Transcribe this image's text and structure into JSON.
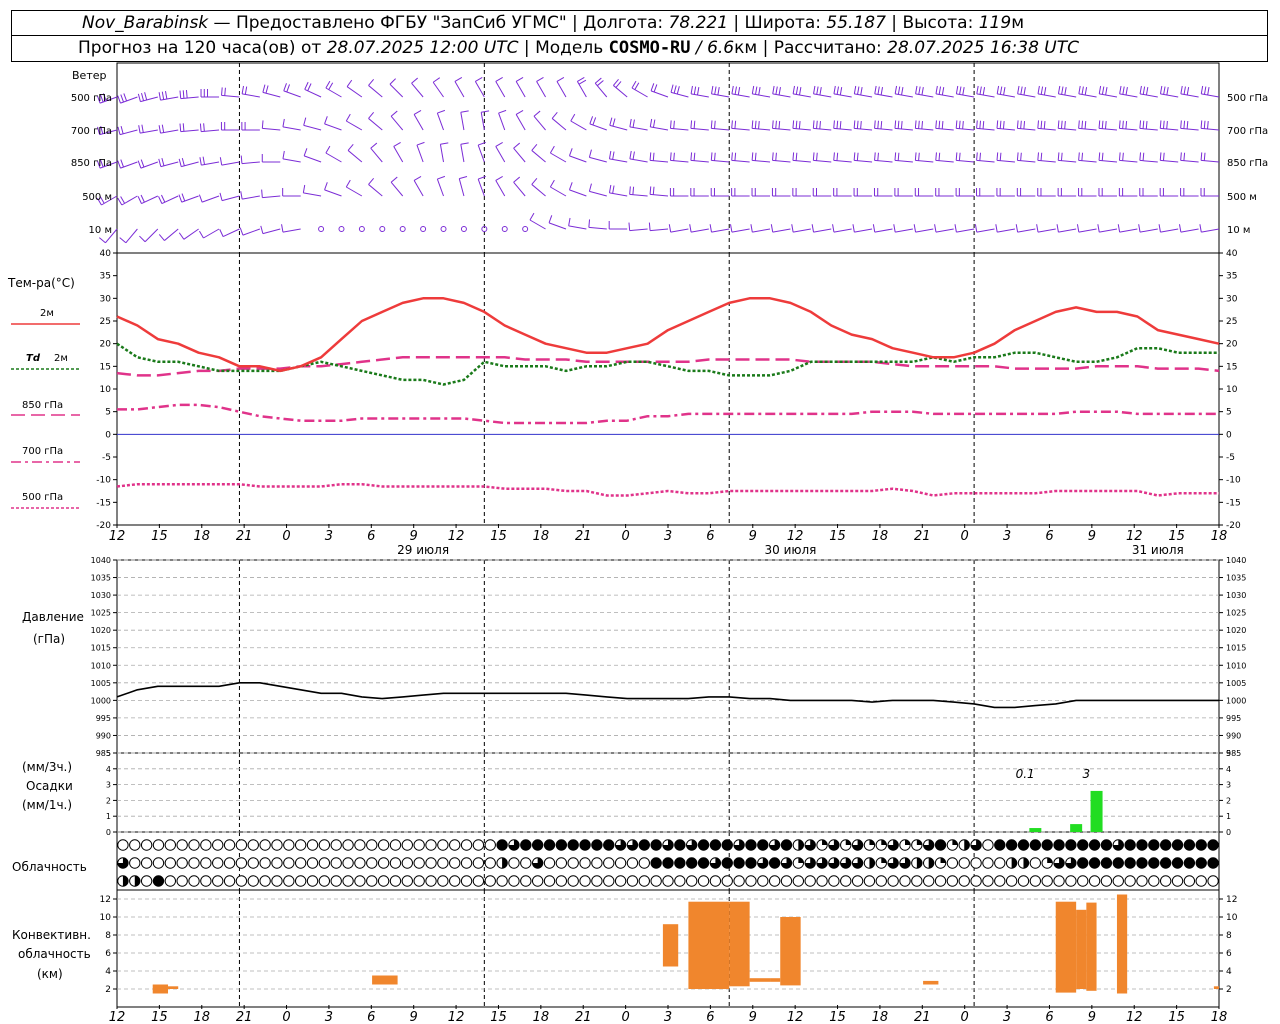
{
  "header": {
    "station": "Nov_Barabinsk",
    "sep1": " — Предоставлено ФГБУ \"ЗапСиб УГМС\" | Долгота: ",
    "lon": "78.221",
    "sep2": " | Широта: ",
    "lat": "55.187",
    "sep3": " | Высота: ",
    "alt": "119",
    "alt_unit": "м",
    "forecast_prefix": "Прогноз на 120 часа(ов) от ",
    "init_time": "28.07.2025 12:00 UTC",
    "model_prefix": " | Модель ",
    "model": "COSMO-RU",
    "res": " / 6.6",
    "res_unit": "км",
    "calc_prefix": " | Рассчитано: ",
    "calc_time": "28.07.2025 16:38 UTC"
  },
  "labels": {
    "wind": "Ветер",
    "wind_levels": [
      "500 гПа",
      "700 гПа",
      "850 гПа",
      "500 м",
      "10 м"
    ],
    "temp_title": "Тем-ра(°С)",
    "t2m": "2м",
    "td_name": "Td",
    "td_level": "2м",
    "l850": "850 гПа",
    "l700": "700 гПа",
    "l500": "500 гПа",
    "pressure": "Давление",
    "pressure_unit": "(гПа)",
    "precip_unit1": "(мм/3ч.)",
    "precip_name": "Осадки",
    "precip_unit2": "(мм/1ч.)",
    "cloud": "Облачность",
    "conv1": "Конвективн.",
    "conv2": "облачность",
    "conv3": "(км)"
  },
  "colors": {
    "t2m": "#ee3b3b",
    "td": "#1a7a1a",
    "t850": "#e0338a",
    "t700": "#e0338a",
    "t500": "#e0338a",
    "wind": "#7b2cd6",
    "pressure": "#000000",
    "precip": "#22dd22",
    "conv": "#f0862d",
    "zero_line": "#3333cc"
  },
  "chart_data": {
    "type": "line",
    "x_hour_ticks": [
      "12",
      "15",
      "18",
      "21",
      "0",
      "3",
      "6",
      "9",
      "12",
      "15",
      "18",
      "21",
      "0",
      "3",
      "6",
      "9",
      "12",
      "15",
      "18",
      "21",
      "0",
      "3",
      "6",
      "9",
      "12",
      "15",
      "18"
    ],
    "day_labels": [
      "29 июля",
      "30 июля",
      "31 июля"
    ],
    "temperature": {
      "ylim": [
        -20,
        40
      ],
      "yticks": [
        -20,
        -15,
        -10,
        -5,
        0,
        5,
        10,
        15,
        20,
        25,
        30,
        35,
        40
      ],
      "t2m": [
        26,
        24,
        21,
        20,
        18,
        17,
        15,
        15,
        14,
        15,
        17,
        21,
        25,
        27,
        29,
        30,
        30,
        29,
        27,
        24,
        22,
        20,
        19,
        18,
        18,
        19,
        20,
        23,
        25,
        27,
        29,
        30,
        30,
        29,
        27,
        24,
        22,
        21,
        19,
        18,
        17,
        17,
        18,
        20,
        23,
        25,
        27,
        28,
        27,
        27,
        26,
        23,
        22,
        21,
        20
      ],
      "td2m": [
        20,
        17,
        16,
        16,
        15,
        14,
        14,
        14,
        14,
        15,
        16,
        15,
        14,
        13,
        12,
        12,
        11,
        12,
        16,
        15,
        15,
        15,
        14,
        15,
        15,
        16,
        16,
        15,
        14,
        14,
        13,
        13,
        13,
        14,
        16,
        16,
        16,
        16,
        16,
        16,
        17,
        16,
        17,
        17,
        18,
        18,
        17,
        16,
        16,
        17,
        19,
        19,
        18,
        18,
        18
      ],
      "t850": [
        13.5,
        13,
        13,
        13.5,
        14,
        14,
        14.5,
        14.5,
        14.5,
        15,
        15,
        15.5,
        16,
        16.5,
        17,
        17,
        17,
        17,
        17,
        17,
        16.5,
        16.5,
        16.5,
        16,
        16,
        16,
        16,
        16,
        16,
        16.5,
        16.5,
        16.5,
        16.5,
        16.5,
        16,
        16,
        16,
        16,
        15.5,
        15,
        15,
        15,
        15,
        15,
        14.5,
        14.5,
        14.5,
        14.5,
        15,
        15,
        15,
        14.5,
        14.5,
        14.5,
        14
      ],
      "t700": [
        5.5,
        5.5,
        6,
        6.5,
        6.5,
        6,
        5,
        4,
        3.5,
        3,
        3,
        3,
        3.5,
        3.5,
        3.5,
        3.5,
        3.5,
        3.5,
        3,
        2.5,
        2.5,
        2.5,
        2.5,
        2.5,
        3,
        3,
        4,
        4,
        4.5,
        4.5,
        4.5,
        4.5,
        4.5,
        4.5,
        4.5,
        4.5,
        4.5,
        5,
        5,
        5,
        4.5,
        4.5,
        4.5,
        4.5,
        4.5,
        4.5,
        4.5,
        5,
        5,
        5,
        4.5,
        4.5,
        4.5,
        4.5,
        4.5
      ],
      "t500": [
        -11.5,
        -11,
        -11,
        -11,
        -11,
        -11,
        -11,
        -11.5,
        -11.5,
        -11.5,
        -11.5,
        -11,
        -11,
        -11.5,
        -11.5,
        -11.5,
        -11.5,
        -11.5,
        -11.5,
        -12,
        -12,
        -12,
        -12.5,
        -12.5,
        -13.5,
        -13.5,
        -13,
        -12.5,
        -13,
        -13,
        -12.5,
        -12.5,
        -12.5,
        -12.5,
        -12.5,
        -12.5,
        -12.5,
        -12.5,
        -12,
        -12.5,
        -13.5,
        -13,
        -13,
        -13,
        -13,
        -13,
        -12.5,
        -12.5,
        -12.5,
        -12.5,
        -12.5,
        -13.5,
        -13,
        -13,
        -13
      ]
    },
    "pressure": {
      "ylim": [
        985,
        1040
      ],
      "yticks": [
        985,
        990,
        995,
        1000,
        1005,
        1010,
        1015,
        1020,
        1025,
        1030,
        1035,
        1040
      ],
      "values": [
        1001,
        1003,
        1004,
        1004,
        1004,
        1004,
        1005,
        1005,
        1004,
        1003,
        1002,
        1002,
        1001,
        1000.5,
        1001,
        1001.5,
        1002,
        1002,
        1002,
        1002,
        1002,
        1002,
        1002,
        1001.5,
        1001,
        1000.5,
        1000.5,
        1000.5,
        1000.5,
        1001,
        1001,
        1000.5,
        1000.5,
        1000,
        1000,
        1000,
        1000,
        999.5,
        1000,
        1000,
        1000,
        999.5,
        999,
        998,
        998,
        998.5,
        999,
        1000,
        1000,
        1000,
        1000,
        1000,
        1000,
        1000,
        1000
      ]
    },
    "precip": {
      "ylim": [
        0,
        5
      ],
      "yticks": [
        0,
        1,
        2,
        3,
        4,
        5
      ],
      "bars": [
        {
          "hour": 90,
          "value": 0.25
        },
        {
          "hour": 94,
          "value": 0.5
        },
        {
          "hour": 96,
          "value": 2.6
        }
      ],
      "annotations": [
        {
          "hour": 89,
          "text": "0.1"
        },
        {
          "hour": 95,
          "text": "3"
        }
      ]
    },
    "convective": {
      "ylim": [
        0,
        13
      ],
      "yticks": [
        2,
        4,
        6,
        8,
        10,
        12
      ],
      "bars": [
        {
          "start": 3.5,
          "end": 5,
          "bottom": 1.5,
          "top": 2.5
        },
        {
          "start": 5,
          "end": 6,
          "bottom": 2,
          "top": 2.3
        },
        {
          "start": 25,
          "end": 27.5,
          "bottom": 2.5,
          "top": 3.5
        },
        {
          "start": 53.5,
          "end": 55,
          "bottom": 4.5,
          "top": 9.2
        },
        {
          "start": 56,
          "end": 60,
          "bottom": 2,
          "top": 11.7
        },
        {
          "start": 60,
          "end": 62,
          "bottom": 2.3,
          "top": 11.7
        },
        {
          "start": 62,
          "end": 64,
          "bottom": 2.8,
          "top": 3.2
        },
        {
          "start": 64,
          "end": 65,
          "bottom": 2.8,
          "top": 3.2
        },
        {
          "start": 65,
          "end": 67,
          "bottom": 2.4,
          "top": 10
        },
        {
          "start": 79,
          "end": 80.5,
          "bottom": 2.5,
          "top": 2.9
        },
        {
          "start": 92,
          "end": 94,
          "bottom": 1.6,
          "top": 11.7
        },
        {
          "start": 94,
          "end": 95,
          "bottom": 2,
          "top": 10.8
        },
        {
          "start": 95,
          "end": 96,
          "bottom": 1.8,
          "top": 11.6
        },
        {
          "start": 98,
          "end": 99,
          "bottom": 1.5,
          "top": 12.5
        },
        {
          "start": 107.5,
          "end": 108,
          "bottom": 2,
          "top": 2.3
        }
      ]
    },
    "cloud_rows": {
      "high": "000000000000000000000000000000004344444444334434344434434231313113113412304444444444344444444",
      "middle": "300000000000000000000000000000002003000000000444443444343133333213322100000220133444444444444",
      "low": "220400000000000000000000000000000000000000000000000000000000000000000000000000000000000000000"
    },
    "wind": {
      "levels": 5,
      "dir": [
        [
          250,
          250,
          255,
          260,
          265,
          270,
          275,
          280,
          285,
          290,
          295,
          300,
          305,
          310,
          315,
          320,
          325,
          330,
          330,
          330,
          330,
          330,
          330,
          330,
          320,
          310,
          300,
          290,
          285,
          280,
          280,
          280,
          280,
          280,
          280,
          280,
          280,
          280,
          280,
          280,
          280,
          280,
          280,
          280,
          280,
          280,
          280,
          280,
          280,
          280,
          280,
          280,
          280,
          280,
          280
        ],
        [
          255,
          255,
          260,
          260,
          265,
          265,
          270,
          270,
          275,
          280,
          285,
          290,
          300,
          310,
          320,
          330,
          340,
          350,
          350,
          340,
          330,
          320,
          310,
          300,
          290,
          285,
          280,
          280,
          275,
          275,
          275,
          275,
          275,
          275,
          275,
          275,
          275,
          275,
          275,
          275,
          275,
          275,
          275,
          275,
          275,
          275,
          275,
          275,
          275,
          275,
          275,
          275,
          275,
          275,
          275
        ],
        [
          250,
          250,
          250,
          255,
          255,
          260,
          260,
          265,
          270,
          280,
          290,
          300,
          310,
          320,
          330,
          340,
          350,
          350,
          340,
          330,
          320,
          310,
          300,
          290,
          285,
          280,
          280,
          275,
          275,
          275,
          275,
          275,
          275,
          275,
          275,
          275,
          275,
          275,
          275,
          275,
          275,
          275,
          275,
          275,
          275,
          275,
          275,
          275,
          275,
          275,
          275,
          275,
          275,
          275,
          275
        ],
        [
          240,
          240,
          245,
          245,
          250,
          250,
          255,
          260,
          265,
          270,
          280,
          290,
          300,
          310,
          320,
          330,
          340,
          345,
          340,
          330,
          320,
          310,
          300,
          290,
          285,
          280,
          275,
          275,
          270,
          270,
          270,
          270,
          270,
          270,
          270,
          270,
          270,
          270,
          270,
          270,
          270,
          270,
          270,
          270,
          270,
          270,
          270,
          270,
          270,
          270,
          270,
          270,
          270,
          270,
          270
        ],
        [
          220,
          220,
          225,
          230,
          235,
          240,
          245,
          250,
          255,
          260,
          270,
          280,
          290,
          300,
          310,
          320,
          330,
          335,
          330,
          320,
          310,
          300,
          290,
          280,
          275,
          270,
          265,
          265,
          260,
          260,
          260,
          260,
          260,
          260,
          260,
          260,
          260,
          260,
          260,
          260,
          260,
          260,
          260,
          260,
          260,
          260,
          260,
          260,
          260,
          260,
          260,
          260,
          260,
          260,
          260
        ]
      ],
      "speed": [
        [
          15,
          15,
          15,
          14,
          14,
          13,
          12,
          11,
          10,
          10,
          9,
          8,
          7,
          7,
          6,
          6,
          6,
          6,
          6,
          6,
          6,
          6,
          7,
          8,
          9,
          10,
          11,
          12,
          13,
          14,
          15,
          15,
          15,
          16,
          16,
          16,
          16,
          16,
          16,
          16,
          16,
          16,
          16,
          16,
          16,
          16,
          16,
          16,
          16,
          16,
          16,
          16,
          16,
          16,
          16
        ],
        [
          12,
          12,
          12,
          11,
          11,
          10,
          9,
          8,
          7,
          7,
          6,
          5,
          5,
          4,
          4,
          3,
          3,
          3,
          3,
          4,
          4,
          5,
          6,
          7,
          8,
          9,
          10,
          11,
          12,
          12,
          12,
          12,
          13,
          13,
          13,
          13,
          13,
          13,
          13,
          13,
          13,
          13,
          13,
          13,
          13,
          13,
          13,
          13,
          13,
          13,
          13,
          13,
          13,
          13,
          13
        ],
        [
          10,
          10,
          10,
          9,
          9,
          8,
          7,
          6,
          5,
          5,
          4,
          4,
          3,
          3,
          3,
          3,
          3,
          3,
          3,
          3,
          4,
          4,
          5,
          6,
          7,
          8,
          9,
          10,
          10,
          10,
          10,
          10,
          10,
          10,
          10,
          10,
          10,
          10,
          10,
          10,
          10,
          10,
          10,
          10,
          10,
          10,
          10,
          10,
          10,
          10,
          10,
          10,
          10,
          10,
          10
        ],
        [
          9,
          9,
          9,
          8,
          8,
          7,
          6,
          5,
          4,
          4,
          3,
          3,
          3,
          3,
          3,
          3,
          3,
          3,
          3,
          3,
          3,
          4,
          5,
          6,
          7,
          8,
          8,
          9,
          9,
          9,
          9,
          9,
          9,
          9,
          9,
          9,
          9,
          9,
          9,
          9,
          9,
          9,
          9,
          9,
          9,
          9,
          9,
          9,
          9,
          9,
          9,
          9,
          9,
          9,
          9
        ],
        [
          6,
          6,
          6,
          5,
          5,
          4,
          4,
          3,
          3,
          3,
          2,
          2,
          2,
          2,
          2,
          2,
          2,
          2,
          2,
          2,
          2,
          3,
          3,
          4,
          5,
          5,
          6,
          6,
          6,
          6,
          6,
          6,
          6,
          6,
          6,
          6,
          6,
          6,
          6,
          6,
          6,
          6,
          6,
          6,
          6,
          6,
          6,
          6,
          6,
          6,
          6,
          6,
          6,
          6,
          6
        ]
      ]
    }
  }
}
